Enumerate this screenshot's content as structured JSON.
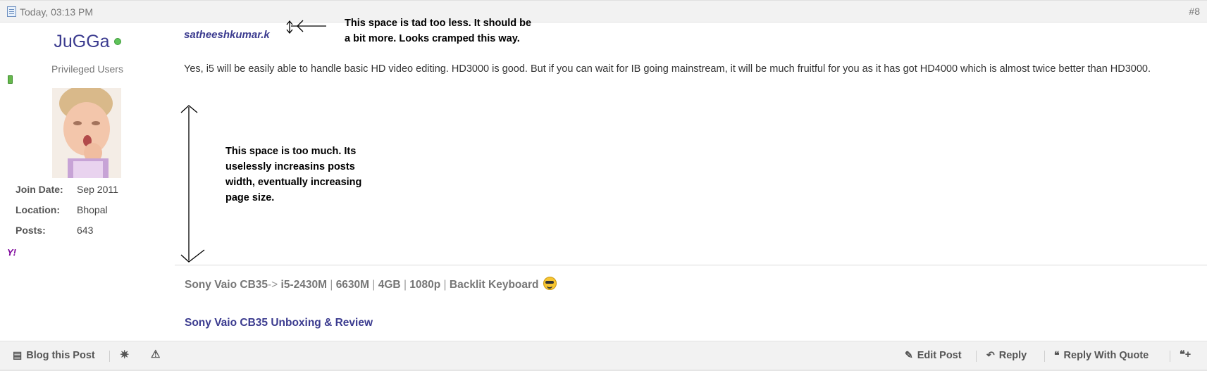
{
  "header": {
    "date": "Today, 03:13 PM",
    "post_number": "#8"
  },
  "user": {
    "name": "JuGGa",
    "title": "Privileged Users",
    "stats": [
      {
        "label": "Join Date:",
        "value": "Sep 2011"
      },
      {
        "label": "Location:",
        "value": "Bhopal"
      },
      {
        "label": "Posts:",
        "value": "643"
      }
    ],
    "yahoo_label": "Y!"
  },
  "message": {
    "quote_author": "satheeshkumar.k",
    "text": "Yes, i5 will be easily able to handle basic HD video editing. HD3000 is good. But if you can wait for IB going mainstream, it will be much fruitful for you as it has got HD4000 which is almost twice better than HD3000."
  },
  "annotations": {
    "top": "This space is tad too less. It should be a bit more. Looks cramped this way.",
    "middle": "This space is too much. Its uselessly increasins posts width, eventually increasing page size."
  },
  "signature": {
    "device": "Sony Vaio CB35",
    "arrow": "->",
    "specs": [
      "i5-2430M",
      "6630M",
      "4GB",
      "1080p",
      "Backlit Keyboard"
    ],
    "link": "Sony Vaio CB35 Unboxing & Review"
  },
  "footer": {
    "blog": "Blog this Post",
    "edit": "Edit Post",
    "reply": "Reply",
    "reply_quote": "Reply With Quote"
  },
  "colors": {
    "username": "#3b3b8f",
    "link": "#3b3b8f",
    "online": "#5fc35a",
    "bar": "#f2f2f2"
  }
}
